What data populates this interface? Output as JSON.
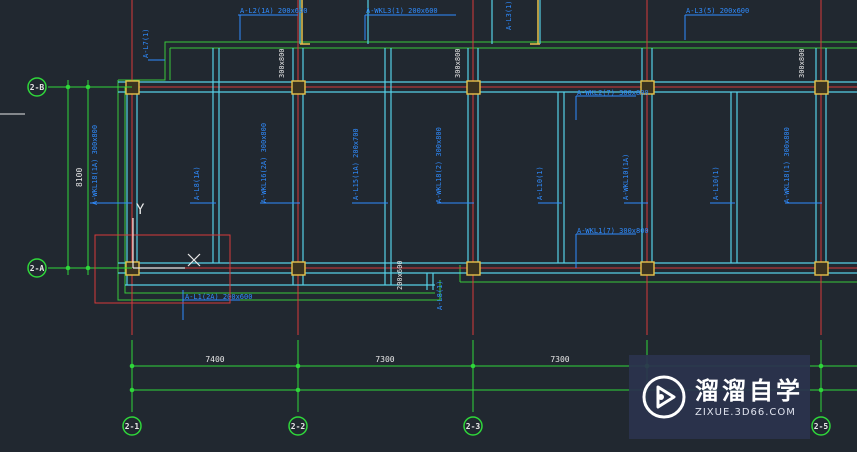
{
  "viewport": {
    "background": "#212830"
  },
  "colors": {
    "grid_axis": "#d83a3a",
    "dimension": "#2fd63a",
    "beam": "#56d0e6",
    "beam_label": "#2f8cff",
    "column": "#e8c24a",
    "text_white": "#e8e8e8",
    "ucs": "#e8e8e8",
    "selection_box": "#d63a3a",
    "slab_edge": "#39c83a"
  },
  "axes": {
    "horizontal": [
      {
        "label": "2-1"
      },
      {
        "label": "2-2"
      },
      {
        "label": "2-3"
      },
      {
        "label": "2-5"
      }
    ],
    "vertical": [
      {
        "label": "2-B"
      },
      {
        "label": "2-A"
      }
    ]
  },
  "dimensions": {
    "spans": [
      "7400",
      "7300",
      "7300"
    ],
    "vertical_span": "8100"
  },
  "beam_labels": {
    "top": [
      "A-L2(1A) 200x600",
      "A-WKL3(1) 200x600",
      "A-L3(5) 200x600",
      "A-L7(1)",
      "A-L3(1)"
    ],
    "vertical": [
      "A-WKL18(1A) 300x800",
      "A-L8(1A)",
      "A-WKL16(2A) 300x800",
      "A-L15(1A) 200x700",
      "A-WKL18(2) 300x800",
      "A-L10(1)",
      "A-WKL10(1A)",
      "A-L10(1)",
      "A-WKL18(1) 300x800"
    ],
    "side": [
      "A-WKL2(7) 300x800",
      "A-WKL1(7) 300x800",
      "A-L1(2A) 200x600",
      "A-L8(1)"
    ],
    "rotated_sizes": [
      "300x800",
      "300x800",
      "300x800",
      "200x600"
    ]
  },
  "ucs": {
    "y_label": "Y",
    "x_marker": "X"
  },
  "watermark": {
    "title": "溜溜自学",
    "url": "ZIXUE.3D66.COM",
    "logo_icon": "play-icon"
  }
}
